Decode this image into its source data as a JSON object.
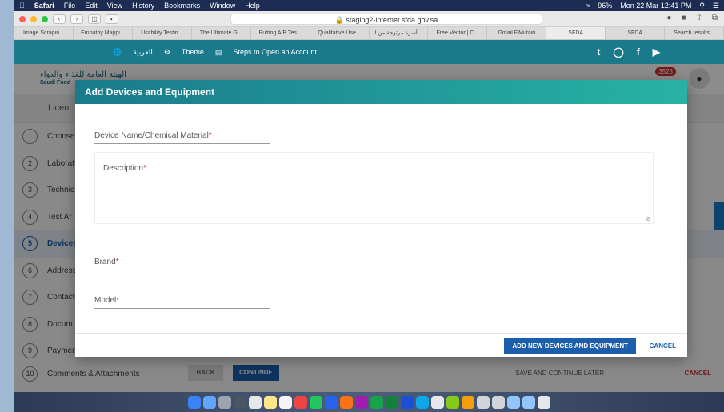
{
  "menubar": {
    "app": "Safari",
    "items": [
      "File",
      "Edit",
      "View",
      "History",
      "Bookmarks",
      "Window",
      "Help"
    ],
    "battery": "96%",
    "clock": "Mon 22 Mar  12:41 PM"
  },
  "browser": {
    "url": "staging2-internet.sfda.gov.sa",
    "tabs": [
      "Image Scrapin...",
      "Empathy Mappi...",
      "Usability Testin...",
      "The Ultimate G...",
      "Putting A/B Tes...",
      "Qualitative Use...",
      "أسرة مرتوجة من ا...",
      "Free Vector | C...",
      "Gmail F.Mutairi",
      "SFDA",
      "SFDA",
      "Search results..."
    ]
  },
  "topbar": {
    "language": "العربية",
    "theme": "Theme",
    "steps_link": "Steps to Open an Account"
  },
  "header": {
    "logo_ar": "الهيئة العامة للغذاء والدواء",
    "logo_en": "Saudi Food",
    "notification_count": "3525"
  },
  "page": {
    "title": "Licen",
    "steps": [
      {
        "num": "1",
        "label": "Choose"
      },
      {
        "num": "2",
        "label": "Laborat"
      },
      {
        "num": "3",
        "label": "Technic"
      },
      {
        "num": "4",
        "label": "Test Ar"
      },
      {
        "num": "5",
        "label": "Devices"
      },
      {
        "num": "6",
        "label": "Address"
      },
      {
        "num": "7",
        "label": "Contact"
      },
      {
        "num": "8",
        "label": "Docum"
      },
      {
        "num": "9",
        "label": "Paymen"
      },
      {
        "num": "10",
        "label": "Comments & Attachments"
      }
    ],
    "back": "BACK",
    "continue": "CONTINUE",
    "save_later": "SAVE AND CONTINUE LATER",
    "cancel": "CANCEL"
  },
  "modal": {
    "title": "Add Devices and Equipment",
    "device_name_label": "Device Name/Chemical Material",
    "description_label": "Description",
    "brand_label": "Brand",
    "model_label": "Model",
    "required_mark": "*",
    "add_button": "ADD NEW DEVICES AND EQUIPMENT",
    "cancel_button": "CANCEL"
  },
  "colors": {
    "teal": "#1a7a8c",
    "primary": "#1b5eab",
    "danger": "#d32f2f"
  }
}
